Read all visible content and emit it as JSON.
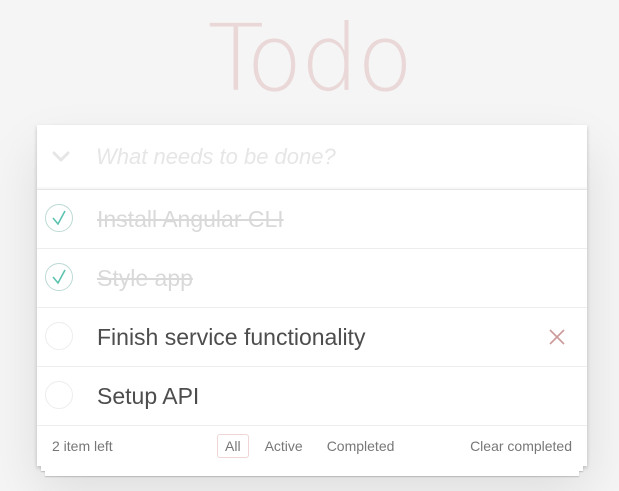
{
  "app": {
    "title": "Todo"
  },
  "new_todo": {
    "placeholder": "What needs to be done?",
    "value": ""
  },
  "todos": [
    {
      "label": "Install Angular CLI",
      "completed": true
    },
    {
      "label": "Style app",
      "completed": true
    },
    {
      "label": "Finish service functionality",
      "completed": false,
      "hovered": true
    },
    {
      "label": "Setup API",
      "completed": false
    }
  ],
  "footer": {
    "count_number": "2",
    "count_text": " item left",
    "filters": [
      {
        "label": "All",
        "selected": true
      },
      {
        "label": "Active",
        "selected": false
      },
      {
        "label": "Completed",
        "selected": false
      }
    ],
    "clear_completed": "Clear completed"
  },
  "colors": {
    "check": "#5dc2af",
    "destroy": "#cc9a9a",
    "title": "#e8d2d2"
  },
  "icons": {
    "toggle_all": "chevron-down-icon",
    "check": "check-icon",
    "destroy": "close-icon"
  }
}
